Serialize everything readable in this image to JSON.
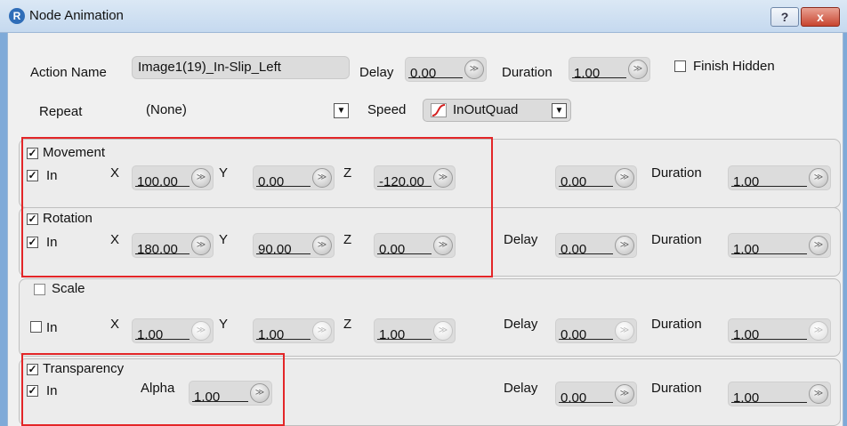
{
  "window": {
    "title": "Node Animation",
    "help_label": "?",
    "close_label": "x"
  },
  "top": {
    "action_name_label": "Action Name",
    "action_name_value": "Image1(19)_In-Slip_Left",
    "delay_label": "Delay",
    "delay_value": "0.00",
    "duration_label": "Duration",
    "duration_value": "1.00",
    "finish_hidden_label": "Finish Hidden",
    "repeat_label": "Repeat",
    "repeat_value": "(None)",
    "speed_label": "Speed",
    "speed_value": "InOutQuad"
  },
  "groups": {
    "movement": {
      "title": "Movement",
      "in_label": "In",
      "x_label": "X",
      "x": "100.00",
      "y_label": "Y",
      "y": "0.00",
      "z_label": "Z",
      "z": "-120.00",
      "delay": "0.00",
      "duration_label": "Duration",
      "duration": "1.00"
    },
    "rotation": {
      "title": "Rotation",
      "in_label": "In",
      "x_label": "X",
      "x": "180.00",
      "y_label": "Y",
      "y": "90.00",
      "z_label": "Z",
      "z": "0.00",
      "delay_label": "Delay",
      "delay": "0.00",
      "duration_label": "Duration",
      "duration": "1.00"
    },
    "scale": {
      "title": "Scale",
      "in_label": "In",
      "x_label": "X",
      "x": "1.00",
      "y_label": "Y",
      "y": "1.00",
      "z_label": "Z",
      "z": "1.00",
      "delay_label": "Delay",
      "delay": "0.00",
      "duration_label": "Duration",
      "duration": "1.00"
    },
    "transparency": {
      "title": "Transparency",
      "in_label": "In",
      "alpha_label": "Alpha",
      "alpha": "1.00",
      "delay_label": "Delay",
      "delay": "0.00",
      "duration_label": "Duration",
      "duration": "1.00"
    }
  },
  "checks": {
    "checked": "✓",
    "unchecked": ""
  },
  "icons": {
    "spin": "≫",
    "dropdown": "▼"
  },
  "colors": {
    "highlight": "#e32628",
    "title_bar": "#c5d9ef"
  }
}
